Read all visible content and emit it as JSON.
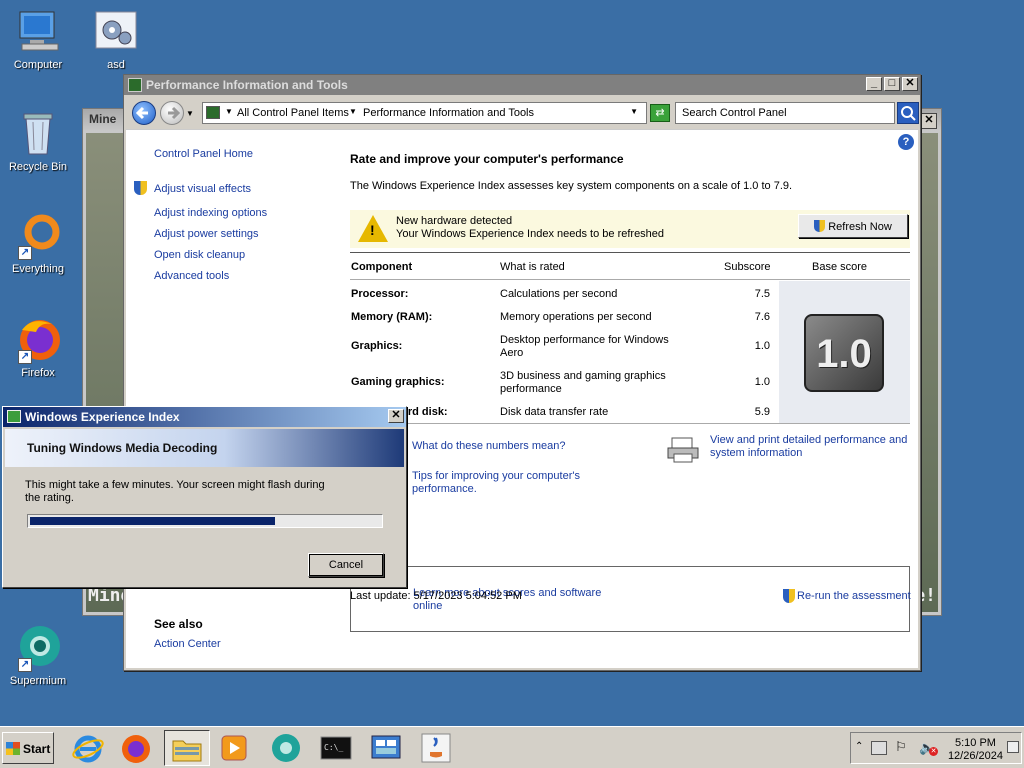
{
  "desktop": {
    "icons": [
      {
        "label": "Computer"
      },
      {
        "label": "asd"
      },
      {
        "label": "Recycle Bin"
      },
      {
        "label": "Everything"
      },
      {
        "label": "Firefox"
      },
      {
        "label": "Supermium"
      }
    ]
  },
  "background_window": {
    "title": "Mine",
    "left_text": "Mine",
    "right_text": "e!"
  },
  "window": {
    "title": "Performance Information and Tools",
    "address": {
      "crumb1": "All Control Panel Items",
      "crumb2": "Performance Information and Tools"
    },
    "search_placeholder": "Search Control Panel",
    "sidebar": {
      "home": "Control Panel Home",
      "links": [
        "Adjust visual effects",
        "Adjust indexing options",
        "Adjust power settings",
        "Open disk cleanup",
        "Advanced tools"
      ],
      "see_also": "See also",
      "action_center": "Action Center"
    },
    "heading": "Rate and improve your computer's performance",
    "intro": "The Windows Experience Index assesses key system components on a scale of 1.0 to 7.9.",
    "notice": {
      "line1": "New hardware detected",
      "line2": "Your Windows Experience Index needs to be refreshed",
      "button": "Refresh Now"
    },
    "table": {
      "headers": [
        "Component",
        "What is rated",
        "Subscore",
        "Base score"
      ],
      "rows": [
        {
          "component": "Processor:",
          "rated": "Calculations per second",
          "subscore": "7.5"
        },
        {
          "component": "Memory (RAM):",
          "rated": "Memory operations per second",
          "subscore": "7.6"
        },
        {
          "component": "Graphics:",
          "rated": "Desktop performance for Windows Aero",
          "subscore": "1.0"
        },
        {
          "component": "Gaming graphics:",
          "rated": "3D business and gaming graphics performance",
          "subscore": "1.0"
        },
        {
          "component": "Primary hard disk:",
          "rated": "Disk data transfer rate",
          "subscore": "5.9"
        }
      ],
      "base_score": "1.0"
    },
    "links": {
      "what_numbers": "What do these numbers mean?",
      "tips": "Tips for improving your computer's performance.",
      "view_print": "View and print detailed performance and system information",
      "learn_more": "Learn more about scores and software online"
    },
    "last_update": "Last update: 5/17/2023 5:04:52 PM",
    "rerun": "Re-run the assessment"
  },
  "dialog": {
    "title": "Windows Experience Index",
    "banner": "Tuning Windows Media Decoding",
    "message": "This might take a few minutes. Your screen might flash during the rating.",
    "progress": 0.7,
    "cancel": "Cancel"
  },
  "taskbar": {
    "start": "Start",
    "time": "5:10 PM",
    "date": "12/26/2024"
  },
  "colors": {
    "desktop": "#3a6ea5",
    "link": "#1a3ca0",
    "progress": "#0a246a"
  }
}
